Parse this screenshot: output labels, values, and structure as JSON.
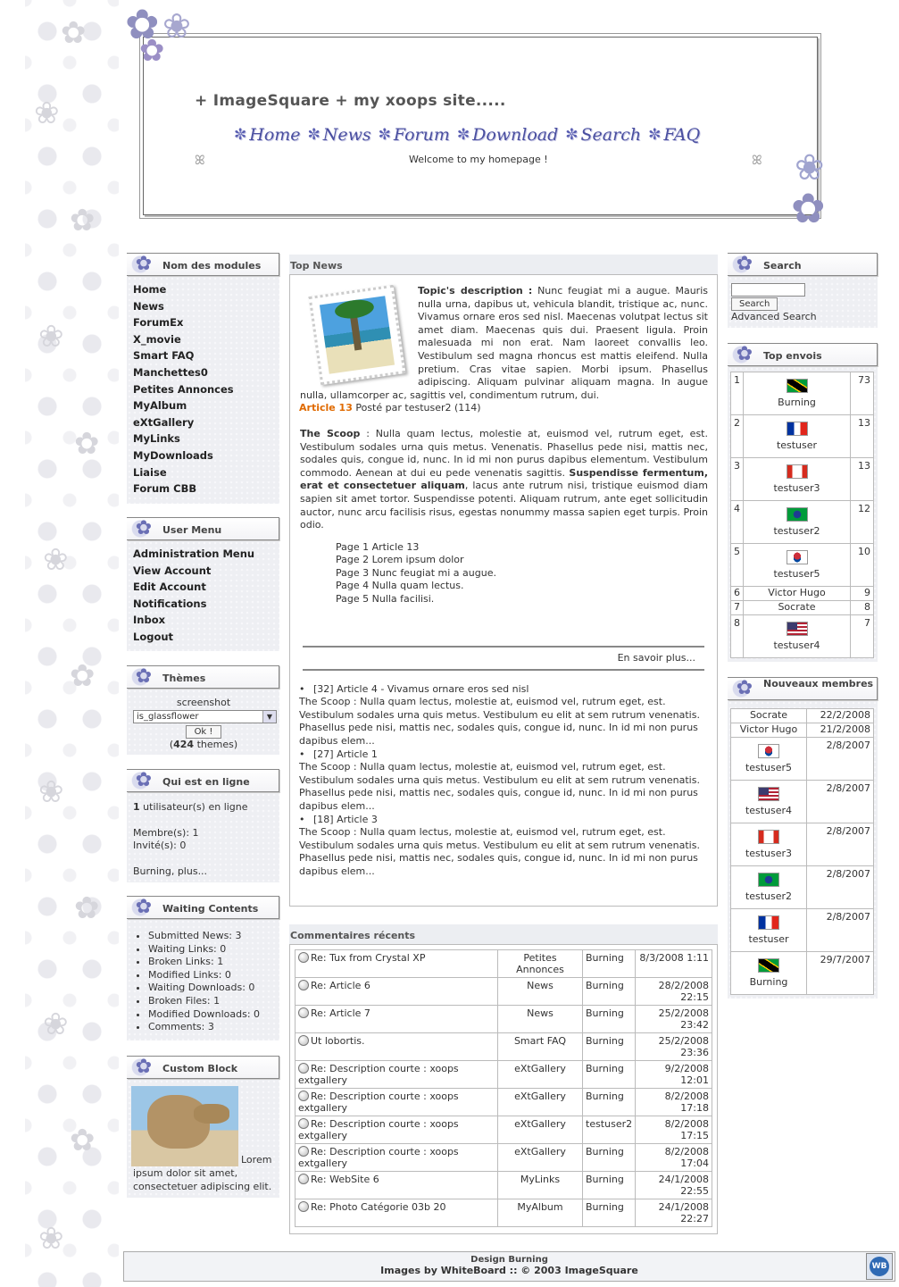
{
  "header": {
    "title": "+ ImageSquare + my xoops site.....",
    "nav": [
      "Home",
      "News",
      "Forum",
      "Download",
      "Search",
      "FAQ"
    ],
    "welcome": "Welcome to my homepage !"
  },
  "modules_block": {
    "title": "Nom des modules",
    "items": [
      "Home",
      "News",
      "ForumEx",
      "X_movie",
      "Smart FAQ",
      "Manchettes0",
      "Petites Annonces",
      "MyAlbum",
      "eXtGallery",
      "MyLinks",
      "MyDownloads",
      "Liaise",
      "Forum CBB"
    ]
  },
  "user_menu": {
    "title": "User Menu",
    "items": [
      "Administration Menu",
      "View Account",
      "Edit Account",
      "Notifications",
      "Inbox",
      "Logout"
    ]
  },
  "themes": {
    "title": "Thèmes",
    "screenshot_label": "screenshot",
    "selected": "is_glassflower",
    "ok": "Ok !",
    "count_prefix": "(",
    "count": "424",
    "count_suffix": " themes)"
  },
  "online": {
    "title": "Qui est en ligne",
    "users_count": "1",
    "users_text": " utilisateur(s) en ligne",
    "members": "Membre(s): 1",
    "guests": "Invité(s): 0",
    "more": "Burning, plus..."
  },
  "waiting": {
    "title": "Waiting Contents",
    "items": [
      "Submitted News: 3",
      "Waiting Links: 0",
      "Broken Links: 1",
      "Modified Links: 0",
      "Waiting Downloads: 0",
      "Broken Files: 1",
      "Modified Downloads: 0",
      "Comments: 3"
    ]
  },
  "custom": {
    "title": "Custom Block",
    "text": "Lorem ipsum dolor sit amet, consectetuer adipiscing elit."
  },
  "top_news": {
    "heading": "Top News",
    "topic_label": "Topic's description :",
    "topic_text": "Nunc feugiat mi a augue. Mauris nulla urna, dapibus ut, vehicula blandit, tristique ac, nunc. Vivamus ornare eros sed nisl. Maecenas volutpat lectus sit amet diam. Maecenas quis dui. Praesent ligula. Proin malesuada mi non erat. Nam laoreet convallis leo. Vestibulum sed magna rhoncus est mattis eleifend. Nulla pretium. Cras vitae sapien. Morbi ipsum. Phasellus adipiscing. Aliquam pulvinar aliquam magna. In augue nulla, ullamcorper ac, sagittis vel, condimentum rutrum, dui.",
    "article_link": "Article 13",
    "posted": " Posté par testuser2 (114)",
    "scoop_label": "The Scoop",
    "scoop_text_1": " : Nulla quam lectus, molestie at, euismod vel, rutrum eget, est. Vestibulum sodales urna quis metus. Venenatis. Phasellus pede nisi, mattis nec, sodales quis, congue id, nunc. In id mi non purus dapibus elementum. Vestibulum commodo. Aenean at dui eu pede venenatis sagittis. ",
    "scoop_bold": "Suspendisse fermentum, erat et consectetuer aliquam",
    "scoop_text_2": ", lacus ante rutrum nisi, tristique euismod diam sapien sit amet tortor. Suspendisse potenti. Aliquam rutrum, ante eget sollicitudin auctor, nunc arcu facilisis risus, egestas nonummy massa sapien eget turpis. Proin odio.",
    "pages": [
      "Page 1 Article 13",
      "Page 2 Lorem ipsum dolor",
      "Page 3 Nunc feugiat mi a augue.",
      "Page 4 Nulla quam lectus.",
      "Page 5 Nulla facilisi."
    ],
    "more": "En savoir plus...",
    "list": [
      {
        "head": "[32] Article 4 - Vivamus ornare eros sed nisl",
        "text": "The Scoop : Nulla quam lectus, molestie at, euismod vel, rutrum eget, est. Vestibulum sodales urna quis metus. Vestibulum eu elit at sem rutrum venenatis. Phasellus pede nisi, mattis nec, sodales quis, congue id, nunc. In id mi non purus dapibus elem..."
      },
      {
        "head": "[27] Article 1",
        "text": "The Scoop : Nulla quam lectus, molestie at, euismod vel, rutrum eget, est. Vestibulum sodales urna quis metus. Vestibulum eu elit at sem rutrum venenatis. Phasellus pede nisi, mattis nec, sodales quis, congue id, nunc. In id mi non purus dapibus elem..."
      },
      {
        "head": "[18] Article 3",
        "text": "The Scoop : Nulla quam lectus, molestie at, euismod vel, rutrum eget, est. Vestibulum sodales urna quis metus. Vestibulum eu elit at sem rutrum venenatis. Phasellus pede nisi, mattis nec, sodales quis, congue id, nunc. In id mi non purus dapibus elem..."
      }
    ]
  },
  "comments": {
    "heading": "Commentaires récents",
    "rows": [
      {
        "title": "Re: Tux from Crystal XP",
        "module": "Petites Annonces",
        "user": "Burning",
        "date": "8/3/2008 1:11"
      },
      {
        "title": "Re: Article 6",
        "module": "News",
        "user": "Burning",
        "date": "28/2/2008 22:15"
      },
      {
        "title": "Re: Article 7",
        "module": "News",
        "user": "Burning",
        "date": "25/2/2008 23:42"
      },
      {
        "title": "Ut lobortis.",
        "module": "Smart FAQ",
        "user": "Burning",
        "date": "25/2/2008 23:36"
      },
      {
        "title": "Re: Description courte : xoops extgallery",
        "module": "eXtGallery",
        "user": "Burning",
        "date": "9/2/2008 12:01"
      },
      {
        "title": "Re: Description courte : xoops extgallery",
        "module": "eXtGallery",
        "user": "Burning",
        "date": "8/2/2008 17:18"
      },
      {
        "title": "Re: Description courte : xoops extgallery",
        "module": "eXtGallery",
        "user": "testuser2",
        "date": "8/2/2008 17:15"
      },
      {
        "title": "Re: Description courte : xoops extgallery",
        "module": "eXtGallery",
        "user": "Burning",
        "date": "8/2/2008 17:04"
      },
      {
        "title": "Re: WebSite 6",
        "module": "MyLinks",
        "user": "Burning",
        "date": "24/1/2008 22:55"
      },
      {
        "title": "Re: Photo Catégorie 03b 20",
        "module": "MyAlbum",
        "user": "Burning",
        "date": "24/1/2008 22:27"
      }
    ]
  },
  "search": {
    "title": "Search",
    "button": "Search",
    "advanced": "Advanced Search"
  },
  "top_posters": {
    "title": "Top envois",
    "rows": [
      {
        "rank": "1",
        "name": "Burning",
        "flag": "jm",
        "count": "73"
      },
      {
        "rank": "2",
        "name": "testuser",
        "flag": "fr",
        "count": "13"
      },
      {
        "rank": "3",
        "name": "testuser3",
        "flag": "ca",
        "count": "13"
      },
      {
        "rank": "4",
        "name": "testuser2",
        "flag": "br",
        "count": "12"
      },
      {
        "rank": "5",
        "name": "testuser5",
        "flag": "kr",
        "count": "10"
      },
      {
        "rank": "6",
        "name": "Victor Hugo",
        "flag": "",
        "count": "9"
      },
      {
        "rank": "7",
        "name": "Socrate",
        "flag": "",
        "count": "8"
      },
      {
        "rank": "8",
        "name": "testuser4",
        "flag": "us",
        "count": "7"
      }
    ]
  },
  "new_members": {
    "title": "Nouveaux membres",
    "rows": [
      {
        "name": "Socrate",
        "flag": "",
        "date": "22/2/2008"
      },
      {
        "name": "Victor Hugo",
        "flag": "",
        "date": "21/2/2008"
      },
      {
        "name": "testuser5",
        "flag": "kr",
        "date": "2/8/2007"
      },
      {
        "name": "testuser4",
        "flag": "us",
        "date": "2/8/2007"
      },
      {
        "name": "testuser3",
        "flag": "ca",
        "date": "2/8/2007"
      },
      {
        "name": "testuser2",
        "flag": "br",
        "date": "2/8/2007"
      },
      {
        "name": "testuser",
        "flag": "fr",
        "date": "2/8/2007"
      },
      {
        "name": "Burning",
        "flag": "jm",
        "date": "29/7/2007"
      }
    ]
  },
  "footer": {
    "line1": "Design Burning",
    "line2": "Images by WhiteBoard :: © 2003 ImageSquare",
    "badge": "WB"
  }
}
